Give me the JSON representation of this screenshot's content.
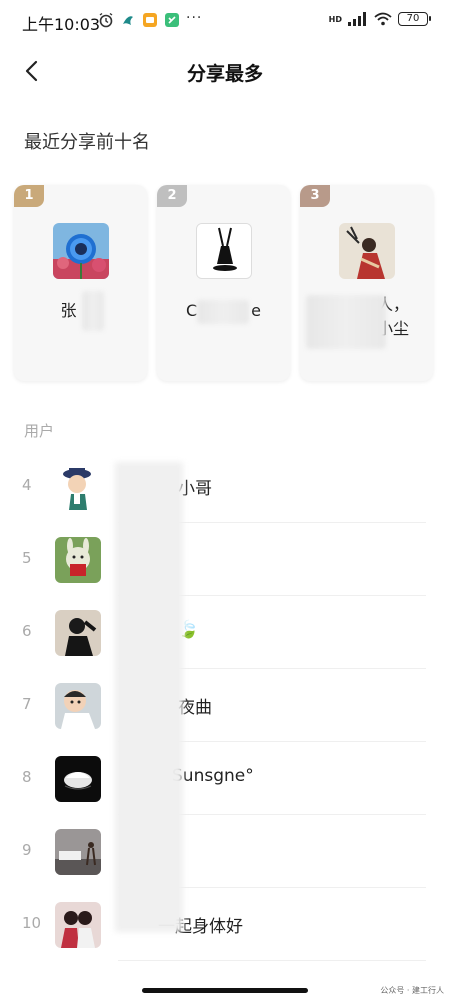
{
  "status_bar": {
    "time": "上午10:03",
    "battery": "70",
    "icons": [
      "alarm-icon",
      "app-icon",
      "app-icon",
      "app-icon",
      "signal-icon",
      "wifi-icon",
      "battery-icon"
    ],
    "network": "HD"
  },
  "nav": {
    "back_icon": "chevron-left-icon",
    "title": "分享最多"
  },
  "top_section": {
    "title": "最近分享前十名",
    "cards": [
      {
        "rank": "1",
        "name": "张",
        "badge_color": "#c9a97a"
      },
      {
        "rank": "2",
        "name_prefix": "C",
        "name_suffix": "e",
        "badge_color": "#bfbfbf"
      },
      {
        "rank": "3",
        "name_line1": "人，",
        "name_line2": "小尘",
        "badge_color": "#b89a8a"
      }
    ]
  },
  "users_section": {
    "label": "用户",
    "rows": [
      {
        "rank": "4",
        "name": "小哥"
      },
      {
        "rank": "5",
        "name": ""
      },
      {
        "rank": "6",
        "name": "🍃"
      },
      {
        "rank": "7",
        "name": "夜曲"
      },
      {
        "rank": "8",
        "name": "Sunsgne°"
      },
      {
        "rank": "9",
        "name": ""
      },
      {
        "rank": "10",
        "name": "一起身体好"
      }
    ]
  },
  "watermark": "公众号 · 建工行人"
}
